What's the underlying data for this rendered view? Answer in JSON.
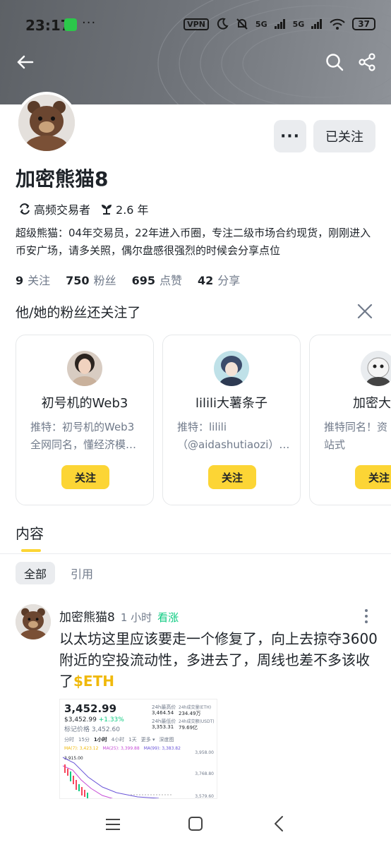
{
  "status_bar": {
    "time": "23:17",
    "more": "···",
    "vpn": "VPN",
    "signal1": "5G",
    "signal2": "5G",
    "battery": "37"
  },
  "header": {
    "icons": [
      "back-arrow-icon",
      "search-icon",
      "share-icon"
    ]
  },
  "profile": {
    "name": "加密熊猫8",
    "more_label": "···",
    "follow_state": "已关注",
    "tags": [
      {
        "icon": "trade-arrows-icon",
        "label": "高频交易者"
      },
      {
        "icon": "sprout-icon",
        "label": "2.6 年"
      }
    ],
    "bio": "超级熊猫：04年交易员，22年进入币圈，专注二级市场合约现货，刚刚进入币安广场，请多关照，偶尔盘感很强烈的时候会分享点位",
    "stats": [
      {
        "value": "9",
        "label": "关注"
      },
      {
        "value": "750",
        "label": "粉丝"
      },
      {
        "value": "695",
        "label": "点赞"
      },
      {
        "value": "42",
        "label": "分享"
      }
    ]
  },
  "suggestions": {
    "title": "他/她的粉丝还关注了",
    "cards": [
      {
        "name": "初号机的Web3",
        "desc": "推特：初号机的Web3 全网同名，懂经济模…",
        "button": "关注"
      },
      {
        "name": "lilili大薯条子",
        "desc": "推特：lilili （@aidashutiaozi）…",
        "button": "关注"
      },
      {
        "name": "加密大师",
        "desc": "推特同名！资 孵化！一站式",
        "button": "关注"
      }
    ]
  },
  "content": {
    "section_title": "内容",
    "filters": {
      "all": "全部",
      "quote": "引用"
    }
  },
  "post": {
    "author": "加密熊猫8",
    "time": "1 小时",
    "sentiment": "看涨",
    "text": "以太坊这里应该要走一个修复了，向上去掠夺3600附近的空投流动性，多进去了，周线也差不多该收了",
    "ticker": "$ETH",
    "chart": {
      "price": "3,452.99",
      "sub_price": "$3,452.99",
      "change": "+1.33%",
      "mark_label": "标记价格 3,452.60",
      "high_label": "24h最高价",
      "high": "3,464.54",
      "low_label": "24h最低价",
      "low": "3,353.31",
      "vol_eth_label": "24h成交量(ETH)",
      "vol_eth": "234.49万",
      "vol_usdt_label": "24h成交额(USDT)",
      "vol_usdt": "79.69亿",
      "tabs": [
        "分时",
        "15分",
        "1小时",
        "4小时",
        "1天",
        "更多 ▾",
        "深度图"
      ],
      "ma7": "MA(7): 3,423.12",
      "ma25": "MA(25): 3,399.88",
      "ma99": "MA(99): 3,383.82",
      "level_left": "3,915.00",
      "y_ticks": [
        "3,958.00",
        "3,768.80",
        "3,579.60"
      ]
    }
  },
  "navbar": {
    "icons": [
      "menu-icon",
      "home-square-icon",
      "back-chevron-icon"
    ]
  }
}
